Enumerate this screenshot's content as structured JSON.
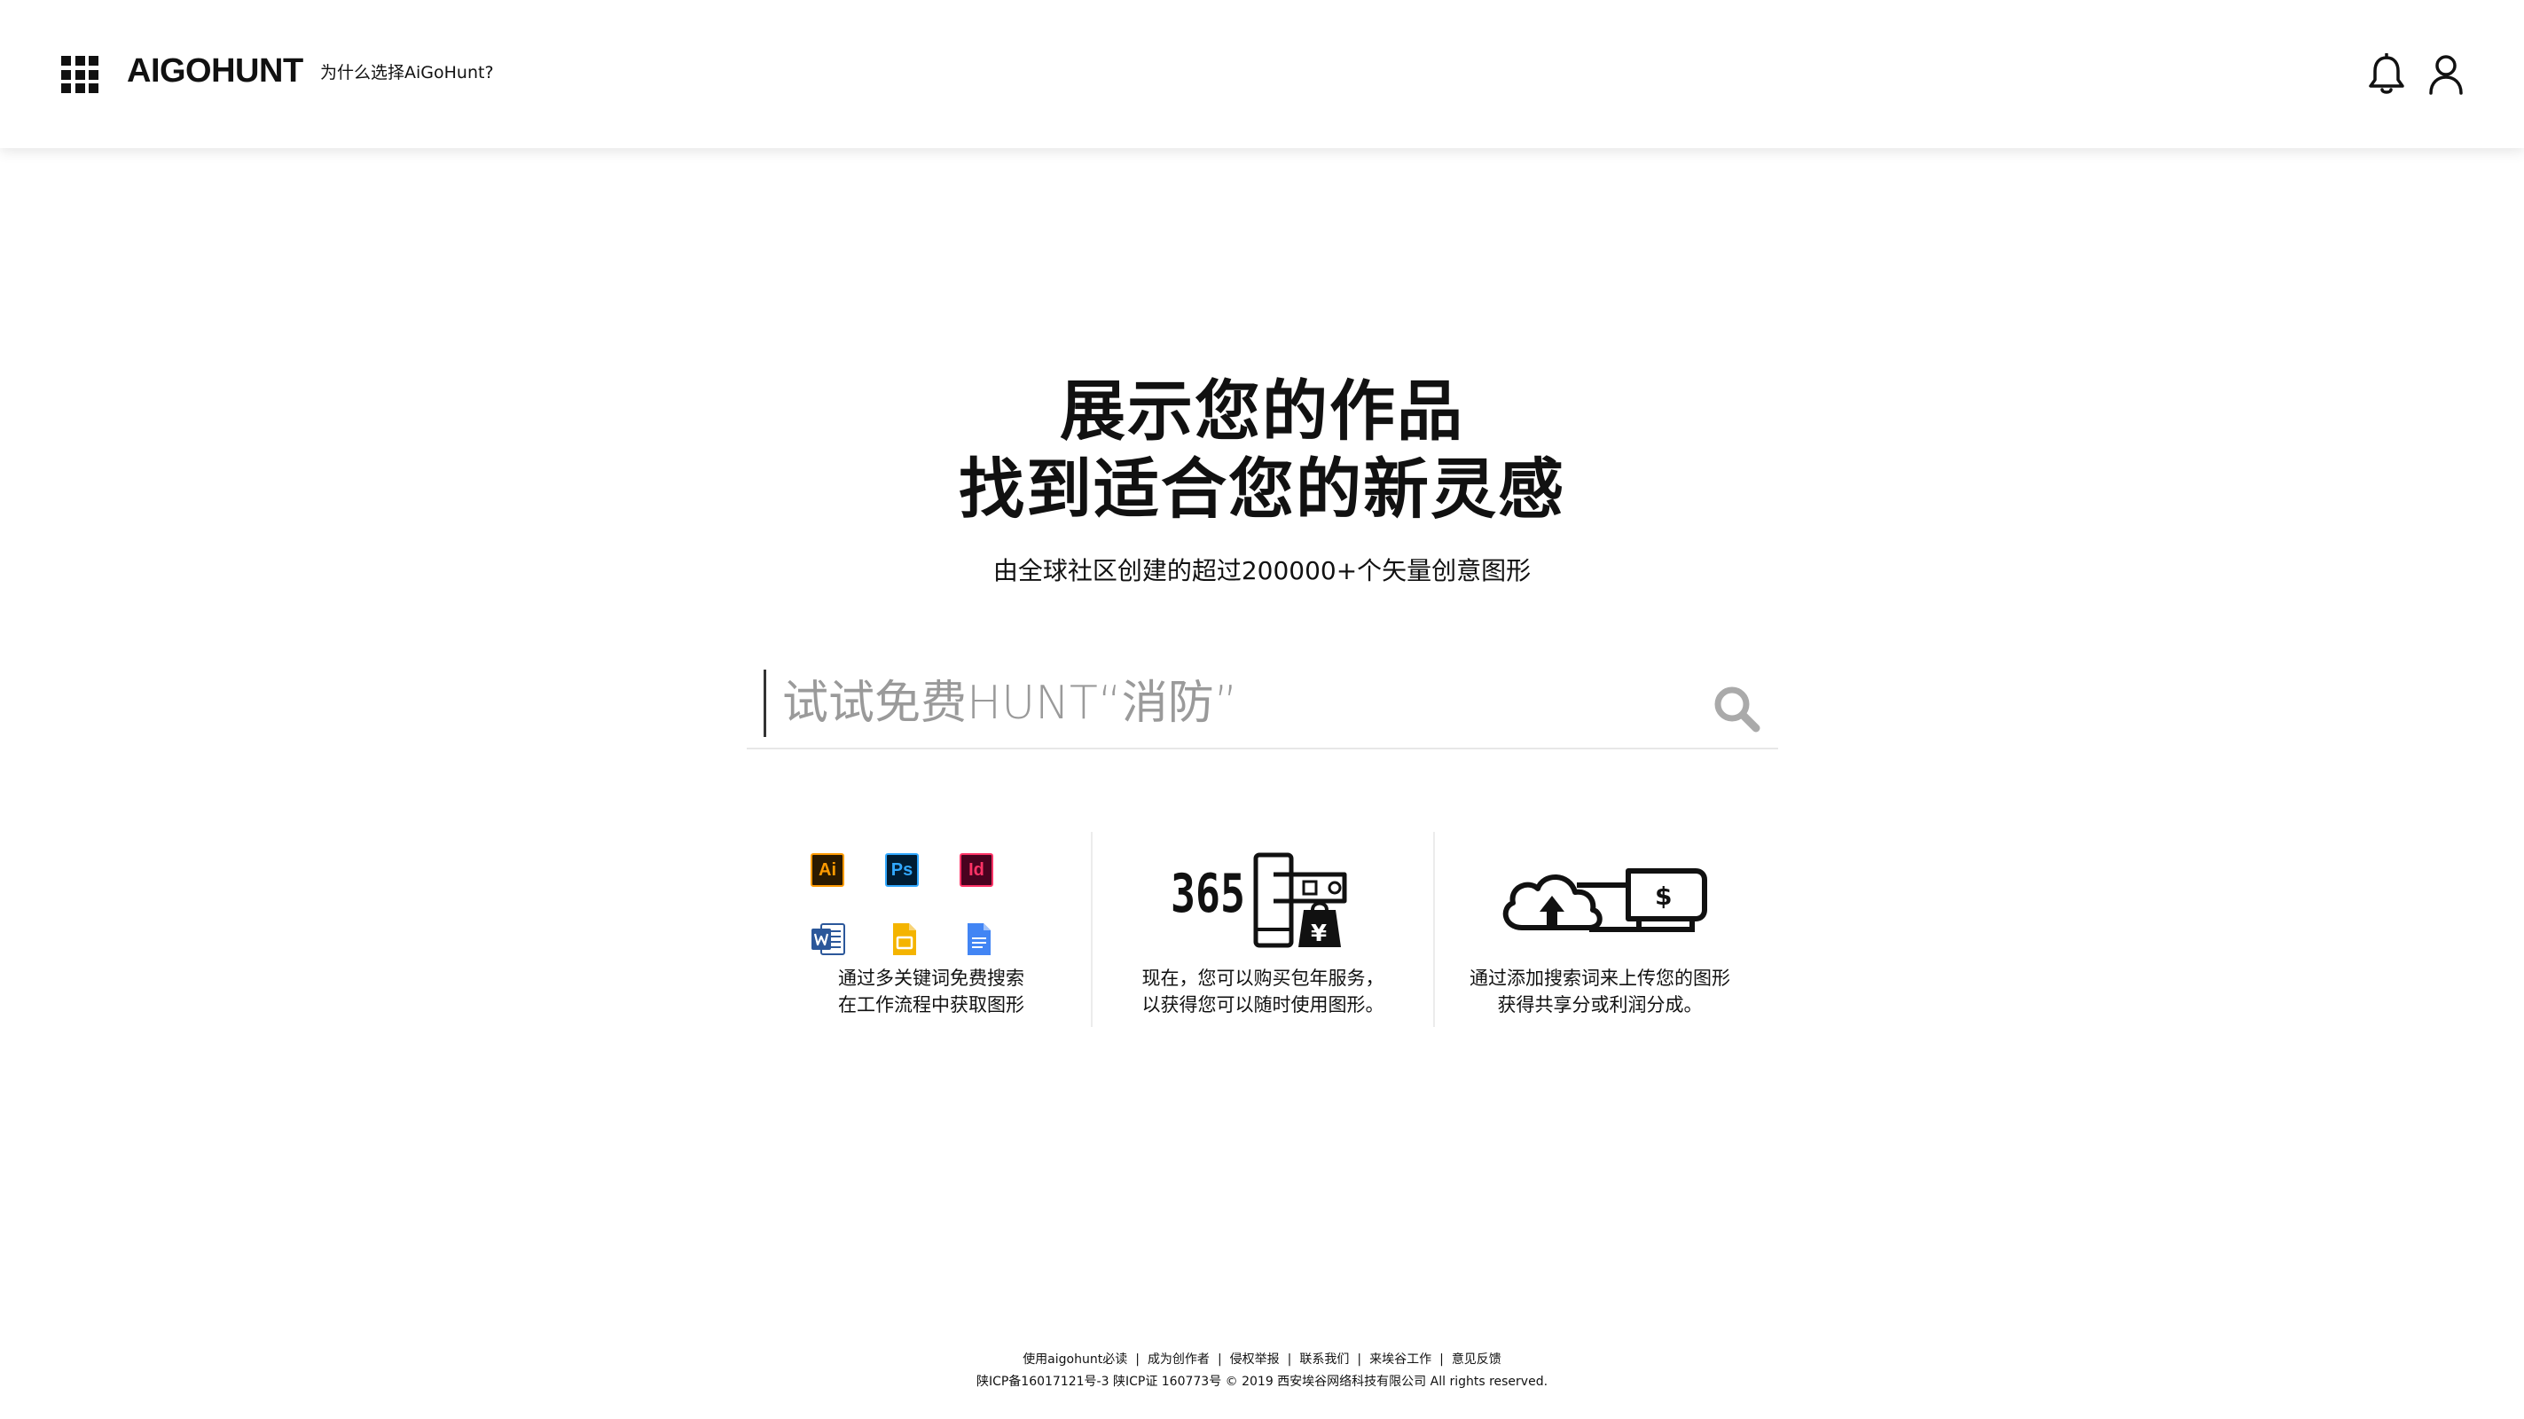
{
  "header": {
    "logo_text": "AIGOHUNT",
    "why_link": "为什么选择AiGoHunt?",
    "icons": [
      "apps-grid-icon",
      "bell-icon",
      "user-icon"
    ]
  },
  "hero": {
    "title_line1": "展示您的作品",
    "title_line2": "找到适合您的新灵感",
    "subtitle": "由全球社区创建的超过200000+个矢量创意图形"
  },
  "search": {
    "placeholder": "试试免费HUNT“消防”",
    "value": "",
    "icon": "search-icon"
  },
  "features": [
    {
      "icon": "app-icons-grid",
      "apps": [
        "Ai",
        "Ps",
        "Id",
        "word-doc-icon",
        "slides-icon",
        "docs-icon"
      ],
      "line1": "通过多关键词免费搜索",
      "line2": "在工作流程中获取图形"
    },
    {
      "icon": "365-shopping-icon",
      "badge": "365",
      "currency": "¥",
      "line1": "现在，您可以购买包年服务，",
      "line2": "以获得您可以随时使用图形。"
    },
    {
      "icon": "cloud-upload-money-icon",
      "currency": "$",
      "line1": "通过添加搜索词来上传您的图形",
      "line2": "获得共享分或利润分成。"
    }
  ],
  "footer": {
    "links": [
      "使用aigohunt必读",
      "成为创作者",
      "侵权举报",
      "联系我们",
      "来埃谷工作",
      "意见反馈"
    ],
    "separator": "|",
    "legal": "陕ICP备16017121号-3 陕ICP证 160773号  © 2019 西安埃谷网络科技有限公司 All rights reserved."
  },
  "colors": {
    "background": "#ffffff",
    "text": "#111111",
    "placeholder": "#9a9a9a",
    "search_icon": "#aaaaaa",
    "divider": "#ececec"
  }
}
